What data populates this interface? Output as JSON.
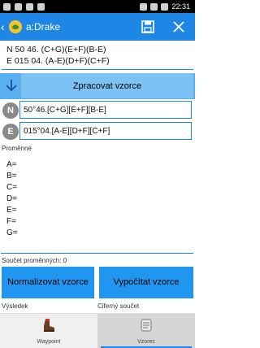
{
  "status": {
    "time": "22:31"
  },
  "app": {
    "title": "a:Drake"
  },
  "coords": {
    "line1": "N 50 46. (C+G)(E+F)(B-E)",
    "line2": "E 015 04. (A-E)(D+F)(C+F)"
  },
  "parse_button": "Zpracovat vzorce",
  "north": {
    "letter": "N",
    "value": "50°46.[C+G][E+F][B-E]"
  },
  "east": {
    "letter": "E",
    "value": "015°04.[A-E][D+F][C+F]"
  },
  "variables_label": "Proměnné",
  "variables": [
    "A=",
    "B=",
    "C=",
    "D=",
    "E=",
    "F=",
    "G="
  ],
  "sum_label": "Součet proměnných: 0",
  "buttons": {
    "normalize": "Normalizovat vzorce",
    "calculate": "Vypočítat vzorce"
  },
  "result_label": "Výsledek",
  "digit_sum_label": "Ciferný součet",
  "tabs": [
    {
      "label": "Waypoint",
      "active": false
    },
    {
      "label": "Vzorec",
      "active": true
    }
  ],
  "colors": {
    "accent": "#1e87e6",
    "button": "#2196f0"
  }
}
